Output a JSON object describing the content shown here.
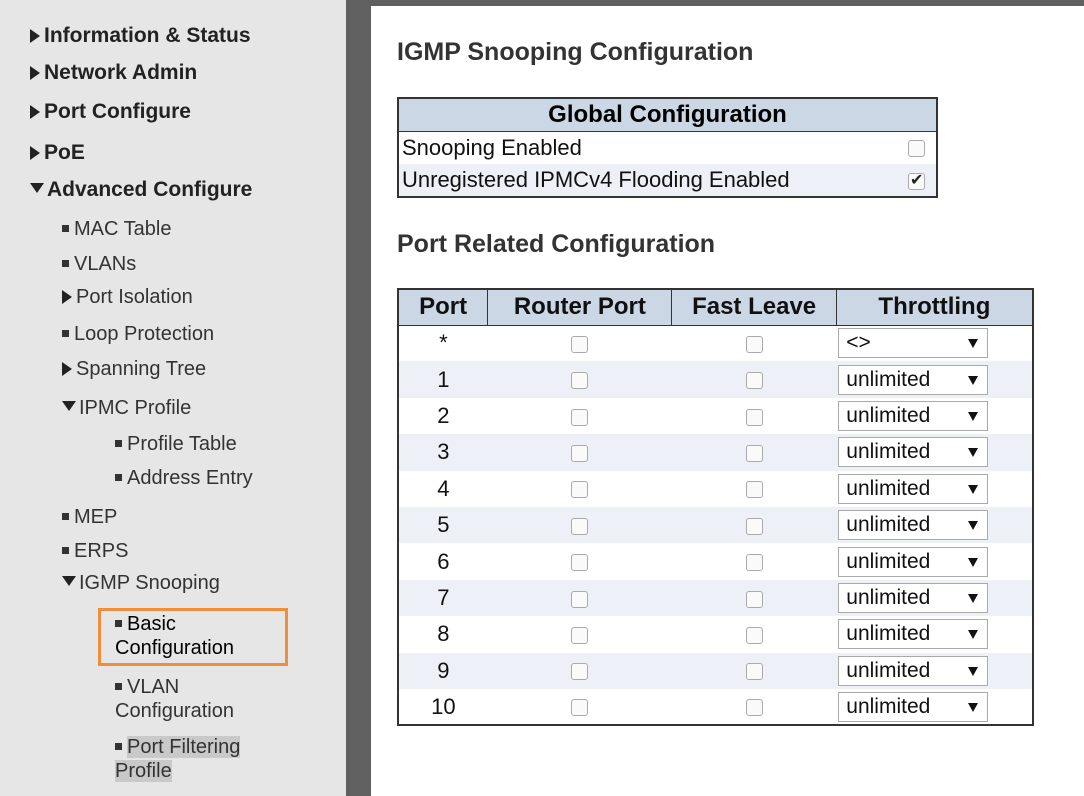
{
  "sidebar": {
    "items": [
      {
        "label": "Information & Status",
        "marker": "triangle-right"
      },
      {
        "label": "Network Admin",
        "marker": "triangle-right"
      },
      {
        "label": "Port Configure",
        "marker": "triangle-right"
      },
      {
        "label": "PoE",
        "marker": "triangle-right"
      },
      {
        "label": "Advanced Configure",
        "marker": "triangle-down"
      },
      {
        "label": "MAC Table",
        "marker": "square-bullet"
      },
      {
        "label": "VLANs",
        "marker": "square-bullet"
      },
      {
        "label": "Port Isolation",
        "marker": "triangle-right"
      },
      {
        "label": "Loop Protection",
        "marker": "square-bullet"
      },
      {
        "label": "Spanning Tree",
        "marker": "triangle-right"
      },
      {
        "label": "IPMC Profile",
        "marker": "triangle-down"
      },
      {
        "label": "Profile Table",
        "marker": "square-bullet"
      },
      {
        "label": "Address Entry",
        "marker": "square-bullet"
      },
      {
        "label": "MEP",
        "marker": "square-bullet"
      },
      {
        "label": "ERPS",
        "marker": "square-bullet"
      },
      {
        "label": "IGMP Snooping",
        "marker": "triangle-down"
      },
      {
        "label": "Basic Configuration",
        "marker": "square-bullet",
        "selected": true
      },
      {
        "label": "VLAN Configuration",
        "marker": "square-bullet"
      },
      {
        "label": "Port Filtering Profile",
        "marker": "square-bullet"
      }
    ],
    "highlight_color": "#f08e3c"
  },
  "main": {
    "title": "IGMP Snooping Configuration",
    "global": {
      "header": "Global Configuration",
      "rows": [
        {
          "label": "Snooping Enabled",
          "checked": false
        },
        {
          "label": "Unregistered IPMCv4 Flooding Enabled",
          "checked": true
        }
      ]
    },
    "port_section_title": "Port Related Configuration",
    "port_table": {
      "columns": [
        "Port",
        "Router Port",
        "Fast Leave",
        "Throttling"
      ],
      "rows": [
        {
          "port": "*",
          "router_port": false,
          "fast_leave": false,
          "throttling": "<>"
        },
        {
          "port": "1",
          "router_port": false,
          "fast_leave": false,
          "throttling": "unlimited"
        },
        {
          "port": "2",
          "router_port": false,
          "fast_leave": false,
          "throttling": "unlimited"
        },
        {
          "port": "3",
          "router_port": false,
          "fast_leave": false,
          "throttling": "unlimited"
        },
        {
          "port": "4",
          "router_port": false,
          "fast_leave": false,
          "throttling": "unlimited"
        },
        {
          "port": "5",
          "router_port": false,
          "fast_leave": false,
          "throttling": "unlimited"
        },
        {
          "port": "6",
          "router_port": false,
          "fast_leave": false,
          "throttling": "unlimited"
        },
        {
          "port": "7",
          "router_port": false,
          "fast_leave": false,
          "throttling": "unlimited"
        },
        {
          "port": "8",
          "router_port": false,
          "fast_leave": false,
          "throttling": "unlimited"
        },
        {
          "port": "9",
          "router_port": false,
          "fast_leave": false,
          "throttling": "unlimited"
        },
        {
          "port": "10",
          "router_port": false,
          "fast_leave": false,
          "throttling": "unlimited"
        }
      ]
    }
  },
  "colors": {
    "table_header_bg": "#ccd7e6",
    "row_alt_bg": "#eef0f7",
    "sidebar_bg": "#e6e6e6",
    "divider": "#606060"
  }
}
